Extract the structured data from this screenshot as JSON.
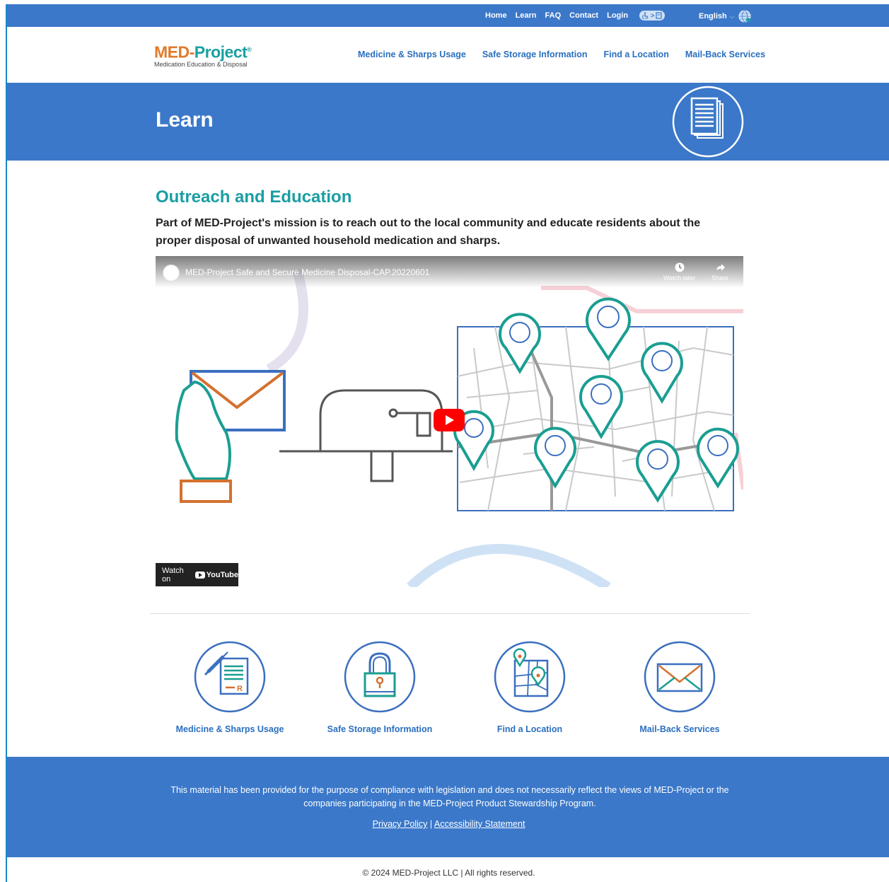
{
  "topbar": {
    "links": [
      "Home",
      "Learn",
      "FAQ",
      "Contact",
      "Login"
    ],
    "language": "English"
  },
  "logo": {
    "name_med": "MED",
    "name_dash": "-",
    "name_project": "Project",
    "registered": "®",
    "tagline": "Medication Education & Disposal"
  },
  "mainnav": {
    "items": [
      "Medicine & Sharps Usage",
      "Safe Storage Information",
      "Find a Location",
      "Mail-Back Services"
    ]
  },
  "hero": {
    "title": "Learn"
  },
  "content": {
    "heading": "Outreach and Education",
    "lead": "Part of MED-Project's mission is to reach out to the local community and educate residents about the proper disposal of unwanted household medication and sharps."
  },
  "video": {
    "title": "MED-Project Safe and Secure Medicine Disposal-CAP.20220601",
    "watch_later": "Watch later",
    "share": "Share",
    "watch_on": "Watch on",
    "youtube": "YouTube"
  },
  "cards": [
    {
      "label": "Medicine & Sharps Usage",
      "icon": "prescription-icon"
    },
    {
      "label": "Safe Storage Information",
      "icon": "padlock-icon"
    },
    {
      "label": "Find a Location",
      "icon": "map-pin-icon"
    },
    {
      "label": "Mail-Back Services",
      "icon": "envelope-icon"
    }
  ],
  "footer": {
    "disclaimer": "This material has been provided for the purpose of compliance with legislation and does not necessarily reflect the views of MED-Project or the companies participating in the MED-Project Product Stewardship Program.",
    "privacy": "Privacy Policy",
    "separator": " | ",
    "accessibility": "Accessibility Statement",
    "copyright": "© 2024 MED-Project LLC | All rights reserved."
  },
  "colors": {
    "brand_blue": "#3b78c9",
    "teal": "#1a9ea3",
    "orange": "#e07b2c",
    "link_blue": "#2a6fc0"
  }
}
